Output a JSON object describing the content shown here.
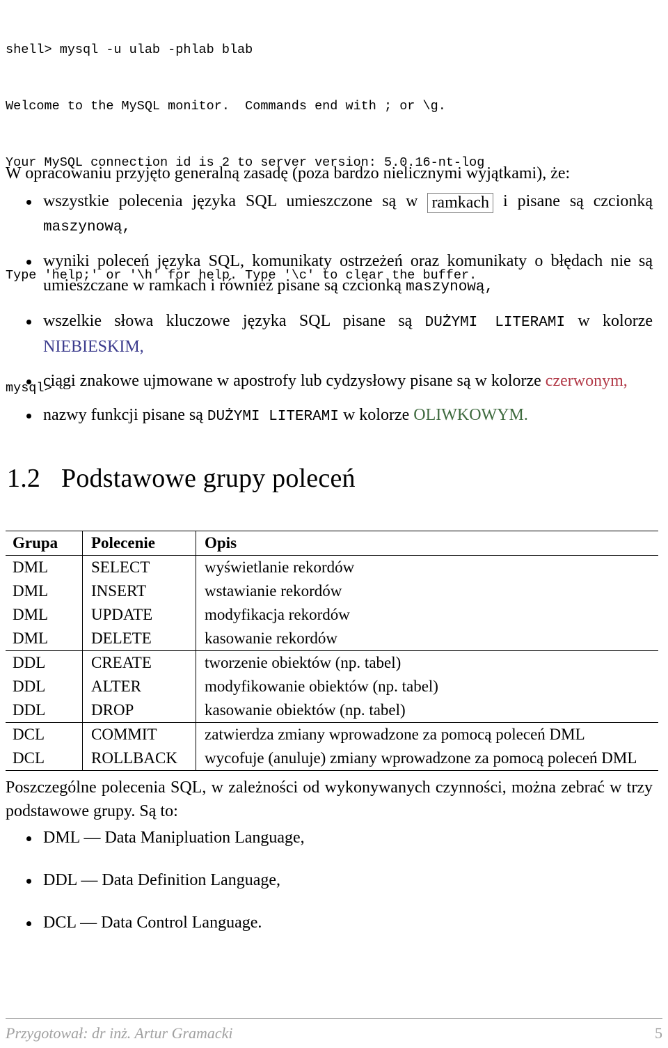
{
  "terminal": {
    "lines": [
      "shell> mysql -u ulab -phlab blab",
      "Welcome to the MySQL monitor.  Commands end with ; or \\g.",
      "Your MySQL connection id is 2 to server version: 5.0.16-nt-log",
      "",
      "Type 'help;' or '\\h' for help. Type '\\c' to clear the buffer.",
      "",
      "mysql>"
    ],
    "line1": "shell> mysql -u ulab -phlab blab",
    "line2": "Welcome to the MySQL monitor.  Commands end with ; or \\g.",
    "line3": "Your MySQL connection id is 2 to server version: 5.0.16-nt-log",
    "line4": "Type 'help;' or '\\h' for help. Type '\\c' to clear the buffer.",
    "line5": "mysql>"
  },
  "intro": {
    "text": "W opracowaniu przyjęto generalną zasadę (poza bardzo nielicznymi wyjątkami), że:"
  },
  "rules": {
    "bullet1": {
      "part1": "wszystkie polecenia języka SQL umieszczone są w",
      "boxed": "ramkach",
      "part2": "i pisane są czcionką",
      "mono": "maszynową,"
    },
    "bullet2": {
      "part1": "wyniki poleceń języka SQL, komunikaty ostrzeżeń oraz komunikaty o błędach nie są umieszczane w ramkach i również pisane są czcionką",
      "mono": "maszynową,"
    },
    "bullet3": {
      "part1": "wszelkie słowa kluczowe języka SQL pisane są",
      "mono": "DUŻYMI LITERAMI",
      "part2": "w kolorze",
      "colored": "NIEBIESKIM,"
    },
    "bullet4": {
      "part1": "ciągi znakowe ujmowane w apostrofy lub cydzysłowy pisane są w kolorze",
      "colored": "czerwonym,"
    },
    "bullet5": {
      "part1": "nazwy funkcji pisane są",
      "mono": "DUŻYMI LITERAMI",
      "part2": "w kolorze",
      "colored": "OLIWKOWYM."
    }
  },
  "section": {
    "number": "1.2",
    "title": "Podstawowe grupy poleceń"
  },
  "table": {
    "headers": [
      "Grupa",
      "Polecenie",
      "Opis"
    ],
    "rows": [
      {
        "grupa": "DML",
        "polecenie": "SELECT",
        "opis": "wyświetlanie rekordów"
      },
      {
        "grupa": "DML",
        "polecenie": "INSERT",
        "opis": "wstawianie rekordów"
      },
      {
        "grupa": "DML",
        "polecenie": "UPDATE",
        "opis": "modyfikacja rekordów"
      },
      {
        "grupa": "DML",
        "polecenie": "DELETE",
        "opis": "kasowanie rekordów"
      },
      {
        "grupa": "DDL",
        "polecenie": "CREATE",
        "opis": "tworzenie obiektów (np. tabel)"
      },
      {
        "grupa": "DDL",
        "polecenie": "ALTER",
        "opis": "modyfikowanie obiektów (np. tabel)"
      },
      {
        "grupa": "DDL",
        "polecenie": "DROP",
        "opis": "kasowanie obiektów (np. tabel)"
      },
      {
        "grupa": "DCL",
        "polecenie": "COMMIT",
        "opis": "zatwierdza zmiany wprowadzone za pomocą poleceń DML"
      },
      {
        "grupa": "DCL",
        "polecenie": "ROLLBACK",
        "opis": "wycofuje (anuluje) zmiany wprowadzone za pomocą poleceń DML"
      }
    ]
  },
  "closing": {
    "text": "Poszczególne polecenia SQL, w zależności od wykonywanych czynności, można zebrać w trzy podstawowe grupy. Są to:"
  },
  "groups": {
    "item1": "DML — Data Manipluation Language,",
    "item2": "DDL — Data Definition Language,",
    "item3": "DCL — Data Control Language."
  },
  "footer": {
    "author": "Przygotował: dr inż. Artur Gramacki",
    "page": "5"
  },
  "colors": {
    "blue": "#3a3a8c",
    "red": "#b23a48",
    "olive": "#3f6b3f",
    "footer_gray": "#a0a0a0",
    "box_border": "#808080"
  }
}
